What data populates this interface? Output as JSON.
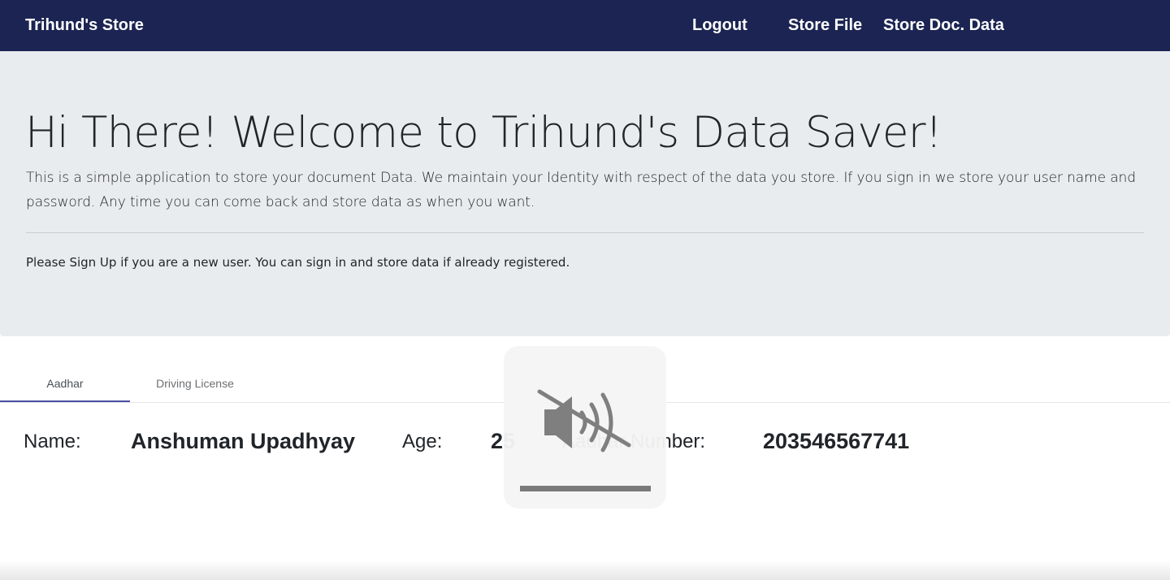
{
  "navbar": {
    "brand": "Trihund's Store",
    "links": [
      "Logout",
      "Store File",
      "Store Doc. Data"
    ]
  },
  "hero": {
    "title": "Hi There! Welcome to Trihund's Data Saver!",
    "lead": "This is a simple application to store your document Data. We maintain your Identity with respect of the data you store. If you sign in we store your user name and password. Any time you can come back and store data as when you want.",
    "hint": "Please Sign Up if you are a new user. You can sign in and store data if already registered."
  },
  "tabs": {
    "items": [
      "Aadhar",
      "Driving License"
    ],
    "active": "Aadhar"
  },
  "record": {
    "name_label": "Name:",
    "name_value": "Anshuman Upadhyay",
    "age_label": "Age:",
    "age_value": "25",
    "aadhar_label": "Aadhar Number:",
    "aadhar_value": "203546567741"
  },
  "volume_overlay": {
    "icon": "speaker-muted-icon",
    "level": 0
  },
  "colors": {
    "navbar_bg": "#1b2452",
    "jumbotron_bg": "#e9ecef",
    "tab_indicator": "#4b4fa3"
  }
}
